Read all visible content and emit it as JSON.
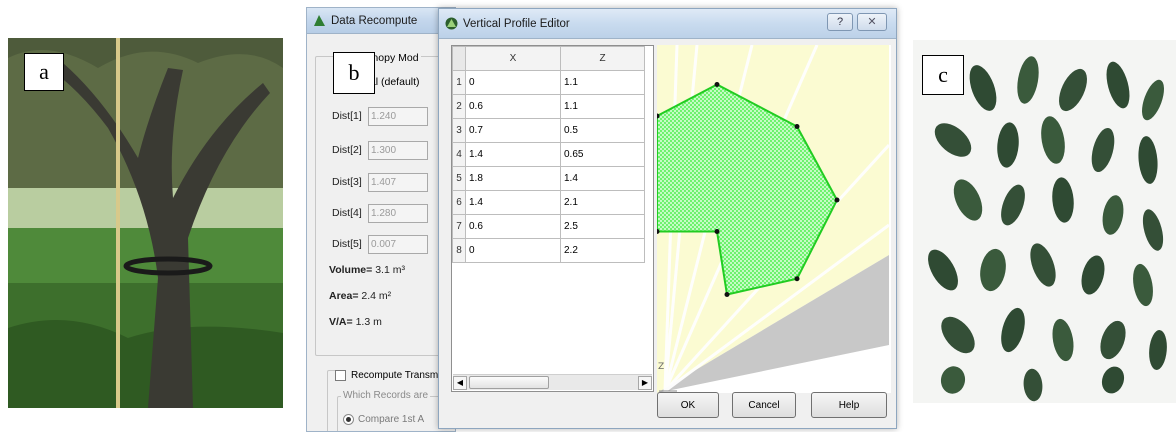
{
  "panels": {
    "a": "a",
    "b": "b",
    "c": "c"
  },
  "data_recompute": {
    "title": "Data Recompute",
    "group_title": "Canopy Mod",
    "radio_label": "tal (default)",
    "dist_rows": [
      {
        "label": "Dist[1]",
        "value": "1.240"
      },
      {
        "label": "Dist[2]",
        "value": "1.300"
      },
      {
        "label": "Dist[3]",
        "value": "1.407"
      },
      {
        "label": "Dist[4]",
        "value": "1.280"
      },
      {
        "label": "Dist[5]",
        "value": "0.007"
      }
    ],
    "volume_label": "Volume=",
    "volume_value": "3.1 m³",
    "area_label": "Area=",
    "area_value": "2.4 m²",
    "va_label": "V/A=",
    "va_value": "1.3 m",
    "recompute_label": "Recompute Transm",
    "which_records_label": "Which Records are",
    "compare_label": "Compare 1st A"
  },
  "profile_editor": {
    "title": "Vertical Profile Editor",
    "help_glyph": "?",
    "close_glyph": "✕",
    "columns": [
      "X",
      "Z"
    ],
    "rows": [
      {
        "n": "1",
        "x": "0",
        "z": "1.1"
      },
      {
        "n": "2",
        "x": "0.6",
        "z": "1.1"
      },
      {
        "n": "3",
        "x": "0.7",
        "z": "0.5"
      },
      {
        "n": "4",
        "x": "1.4",
        "z": "0.65"
      },
      {
        "n": "5",
        "x": "1.8",
        "z": "1.4"
      },
      {
        "n": "6",
        "x": "1.4",
        "z": "2.1"
      },
      {
        "n": "7",
        "x": "0.6",
        "z": "2.5"
      },
      {
        "n": "8",
        "x": "0",
        "z": "2.2"
      }
    ],
    "axis_label": "Z",
    "buttons": {
      "ok": "OK",
      "cancel": "Cancel",
      "help": "Help"
    },
    "colors": {
      "polygon_stroke": "#22cc22",
      "polygon_fill": "#5cf05c",
      "sky": "#fbfbd2",
      "ground": "#c8c8c8"
    }
  }
}
